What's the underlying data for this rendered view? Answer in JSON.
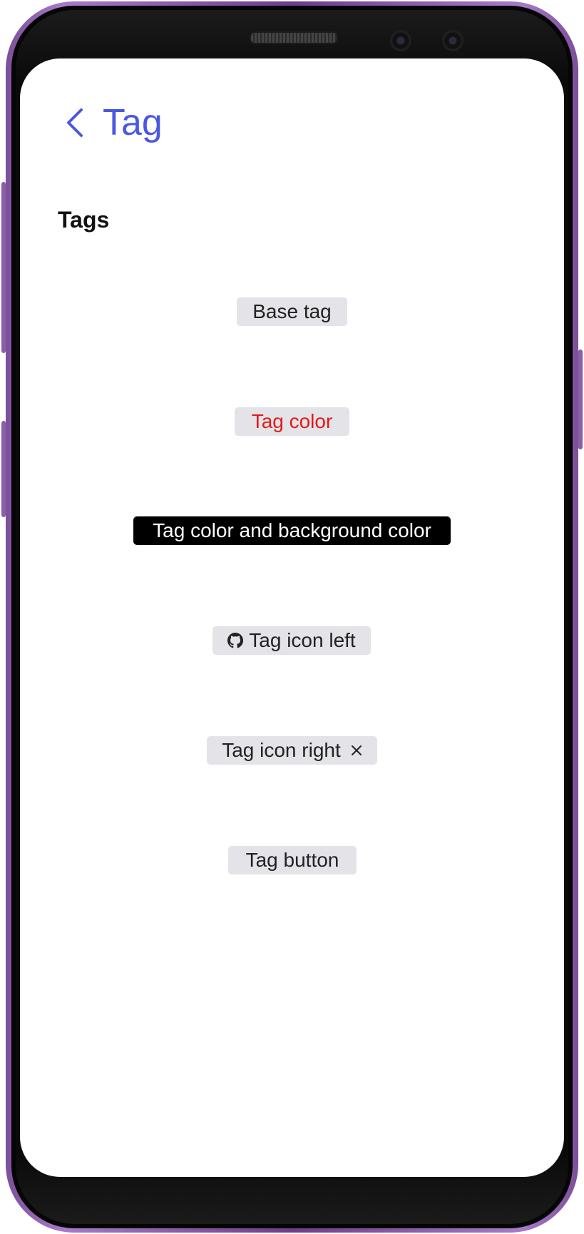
{
  "header": {
    "back_icon": "chevron-left-icon",
    "title": "Tag"
  },
  "section": {
    "title": "Tags"
  },
  "colors": {
    "accent": "#4a58e0",
    "tag_background": "#e3e3e8",
    "tag_text": "#222222",
    "tag_color_text": "#e01a1a",
    "dark_tag_background": "#000000",
    "dark_tag_text": "#ffffff",
    "phone_frame": "#8a5fa9"
  },
  "tags": {
    "base": {
      "label": "Base tag"
    },
    "color": {
      "label": "Tag color"
    },
    "color_background": {
      "label": "Tag color and background color"
    },
    "icon_left": {
      "label": "Tag icon left",
      "icon": "github-icon"
    },
    "icon_right": {
      "label": "Tag icon right",
      "icon": "close-icon"
    },
    "button": {
      "label": "Tag button"
    }
  }
}
